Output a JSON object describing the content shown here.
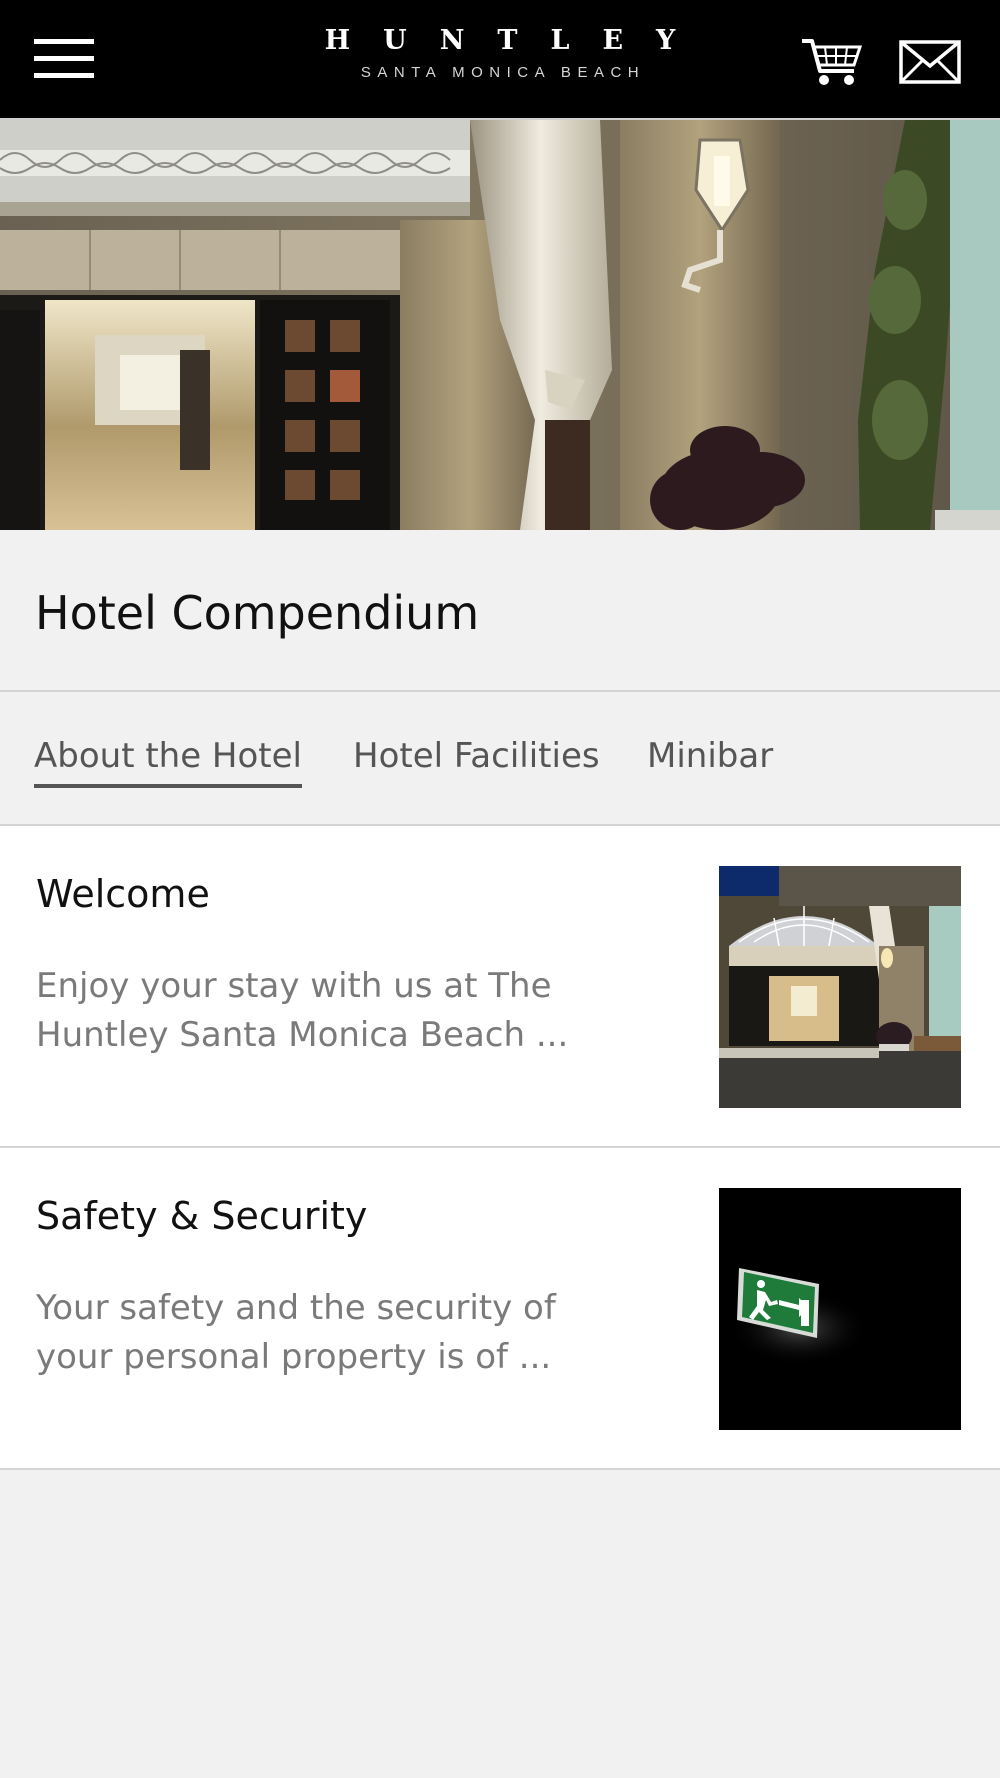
{
  "header": {
    "brand_main": "HUNTLEY",
    "brand_sub": "SANTA MONICA BEACH",
    "menu_icon": "hamburger-menu-icon",
    "cart_icon": "shopping-cart-icon",
    "mail_icon": "envelope-icon",
    "background_color": "#000000"
  },
  "page": {
    "title": "Hotel Compendium"
  },
  "tabs": [
    {
      "label": "About the Hotel",
      "active": true
    },
    {
      "label": "Hotel Facilities",
      "active": false
    },
    {
      "label": "Minibar",
      "active": false
    }
  ],
  "items": [
    {
      "title": "Welcome",
      "description": "Enjoy your stay with us at The Huntley Santa Monica Beach ..."
    },
    {
      "title": "Safety & Security",
      "description": "Your safety and the security of your personal property is of ..."
    }
  ]
}
